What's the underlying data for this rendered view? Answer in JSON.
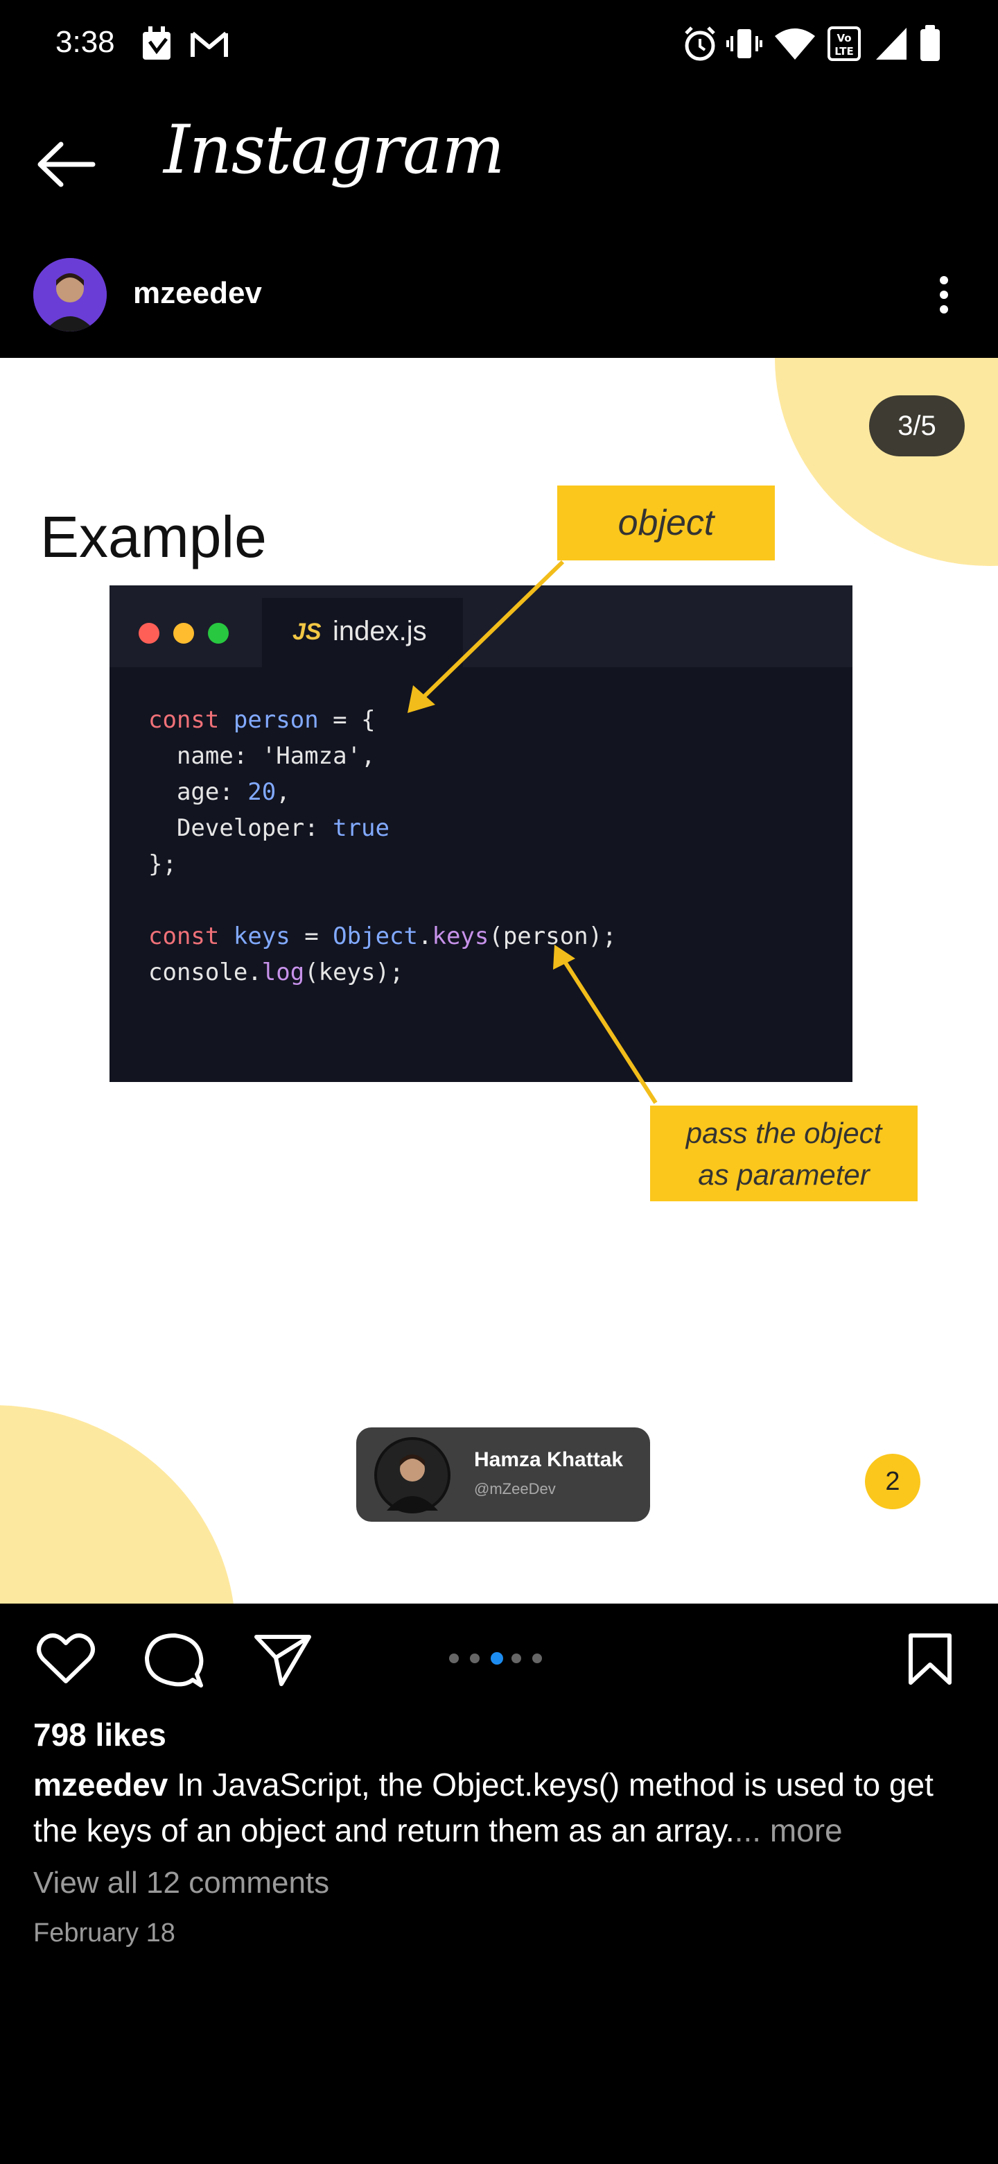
{
  "status_bar": {
    "time": "3:38"
  },
  "header": {
    "title": "Instagram"
  },
  "post": {
    "username": "mzeedev",
    "slide_counter": "3/5",
    "slide": {
      "heading": "Example",
      "object_callout": "object",
      "param_callout_line1": "pass the object",
      "param_callout_line2": "as parameter",
      "tab_badge": "JS",
      "tab_filename": "index.js",
      "code": {
        "l1_kw": "const",
        "l1_var": "person",
        "l1_rest": " = {",
        "l2": "  name: 'Hamza',",
        "l3_key": "  age: ",
        "l3_num": "20",
        "l3_end": ",",
        "l4_key": "  Developer: ",
        "l4_val": "true",
        "l5": "};",
        "l7_kw": "const",
        "l7_var": "keys",
        "l7_eq": " = ",
        "l7_obj": "Object",
        "l7_dot": ".",
        "l7_fn": "keys",
        "l7_args": "(person);",
        "l8_obj": "console.",
        "l8_fn": "log",
        "l8_args": "(keys);"
      },
      "author_name": "Hamza Khattak",
      "author_handle": "@mZeeDev",
      "page_number": "2"
    },
    "carousel": {
      "total": 5,
      "active_index": 2
    },
    "likes": "798 likes",
    "caption_user": "mzeedev",
    "caption_text": " In JavaScript, the Object.keys() method is used to get the keys of an object and return them as an array.",
    "caption_more": "... more",
    "view_comments": "View all 12 comments",
    "date": "February 18"
  },
  "colors": {
    "accent_yellow": "#fbc71c",
    "deco_yellow": "#fde89f",
    "carousel_active": "#1d8cf0"
  },
  "icons": {
    "status": [
      "notification-icon",
      "gmail-icon",
      "alarm-icon",
      "vibrate-icon",
      "wifi-icon",
      "volte-icon",
      "signal-icon",
      "battery-icon"
    ],
    "actions": [
      "heart-icon",
      "comment-icon",
      "share-icon",
      "bookmark-icon"
    ]
  }
}
